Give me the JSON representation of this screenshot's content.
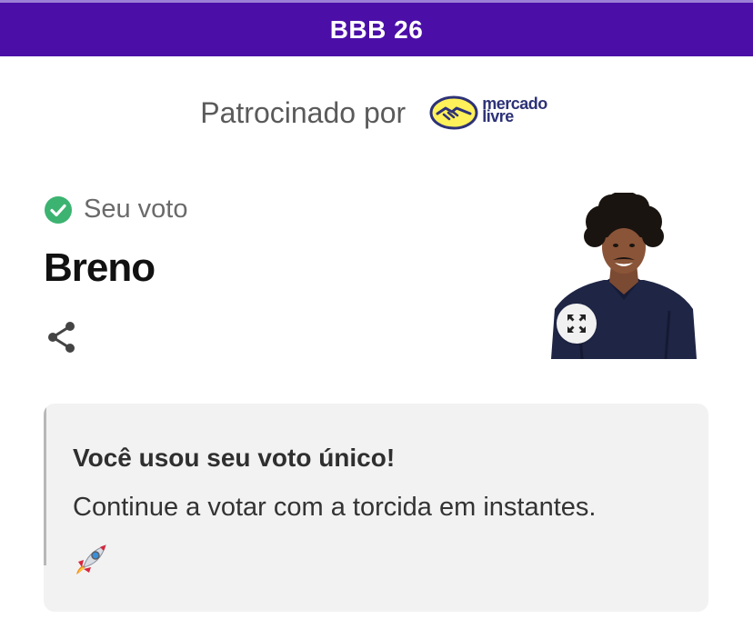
{
  "header": {
    "title": "BBB 26",
    "color": "#4b0fa8"
  },
  "sponsor": {
    "label": "Patrocinado por",
    "brand_line1": "mercado",
    "brand_line2": "livre",
    "brand_icon": "handshake-icon"
  },
  "vote": {
    "status_label": "Seu voto",
    "status_icon": "check-circle-icon",
    "status_color": "#3cb371",
    "candidate_name": "Breno",
    "share_icon": "share-icon",
    "expand_icon": "expand-icon"
  },
  "notice": {
    "title": "Você usou seu voto único!",
    "body": "Continue a votar com a torcida em instantes.",
    "emoji": "rocket-icon"
  }
}
